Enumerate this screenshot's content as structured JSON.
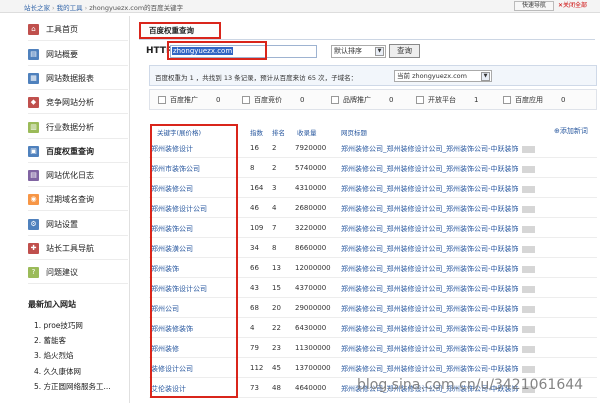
{
  "breadcrumb": {
    "items": [
      "站长之家",
      "我的工具",
      "zhongyuezx.com的百度关键字"
    ]
  },
  "top": {
    "quicknav": "快速导航",
    "close_all": "关闭全部"
  },
  "sidebar": {
    "items": [
      {
        "label": "工具首页",
        "icon": "home-icon",
        "color": "#c0504d"
      },
      {
        "label": "网站概要",
        "icon": "overview-icon",
        "color": "#4f81bd"
      },
      {
        "label": "网站数据报表",
        "icon": "report-icon",
        "color": "#4f81bd"
      },
      {
        "label": "竞争网站分析",
        "icon": "compete-icon",
        "color": "#c0504d"
      },
      {
        "label": "行业数据分析",
        "icon": "industry-icon",
        "color": "#9bbb59"
      },
      {
        "label": "百度权重查询",
        "icon": "baidu-weight-icon",
        "color": "#4f81bd"
      },
      {
        "label": "网站优化日志",
        "icon": "log-icon",
        "color": "#8064a2"
      },
      {
        "label": "过期域名查询",
        "icon": "expired-domain-icon",
        "color": "#f79646"
      },
      {
        "label": "网站设置",
        "icon": "settings-icon",
        "color": "#4f81bd"
      },
      {
        "label": "站长工具导航",
        "icon": "nav-icon",
        "color": "#c0504d"
      },
      {
        "label": "问题建议",
        "icon": "question-icon",
        "color": "#9bbb59"
      }
    ],
    "section_title": "最新加入网站",
    "sites": [
      "1. proe技巧网",
      "2. 蓄能客",
      "3. 焰火烈焰",
      "4. 久久康体网",
      "5. 方正圆网络服务工..."
    ]
  },
  "main": {
    "title": "百度权重查询",
    "http_label": "HTTP://",
    "domain_value": "zhongyuezx.com",
    "sort_value": "默认排序",
    "query_label": "查询",
    "summary_text": "百度权重为 1 ，共找到 13 条记录，预计从百度来访 65 次，子域名：",
    "site_select": "当前 zhongyuezx.com",
    "filters": [
      {
        "label": "百度推广",
        "count": "0"
      },
      {
        "label": "百度竞价",
        "count": "0"
      },
      {
        "label": "品牌推广",
        "count": "0"
      },
      {
        "label": "开放平台",
        "count": "1"
      },
      {
        "label": "百度应用",
        "count": "0"
      }
    ],
    "columns": {
      "keyword": "关键字(展价格)",
      "index": "指数",
      "rank": "排名",
      "inclusion": "收录量",
      "title": "网页标题"
    },
    "add_link": "添加新词",
    "rows": [
      {
        "kw": "郑州装修设计",
        "idx": "16",
        "rank": "2",
        "inc": "7920000",
        "ttl_b": "郑州装修公司_郑州装修设计公司_郑州装饰公司-中跃装饰"
      },
      {
        "kw": "郑州市装饰公司",
        "idx": "8",
        "rank": "2",
        "inc": "5740000",
        "ttl_b": "郑州装修公司_郑州装修设计公司_郑州装饰公司-中跃装饰"
      },
      {
        "kw": "郑州装修公司",
        "idx": "164",
        "rank": "3",
        "inc": "4310000",
        "ttl_b": "郑州装修公司_郑州装修设计公司_郑州装饰公司-中跃装饰"
      },
      {
        "kw": "郑州装修设计公司",
        "idx": "46",
        "rank": "4",
        "inc": "2680000",
        "ttl_b": "郑州装修公司_郑州装修设计公司_郑州装饰公司-中跃装饰"
      },
      {
        "kw": "郑州装饰公司",
        "idx": "109",
        "rank": "7",
        "inc": "3220000",
        "ttl_b": "郑州装修公司_郑州装修设计公司_郑州装饰公司-中跃装饰"
      },
      {
        "kw": "郑州装潢公司",
        "idx": "34",
        "rank": "8",
        "inc": "8660000",
        "ttl_b": "郑州装修公司_郑州装修设计公司_郑州装饰公司-中跃装饰"
      },
      {
        "kw": "郑州装饰",
        "idx": "66",
        "rank": "13",
        "inc": "12000000",
        "ttl_b": "郑州装修公司_郑州装修设计公司_郑州装饰公司-中跃装饰"
      },
      {
        "kw": "郑州装饰设计公司",
        "idx": "43",
        "rank": "15",
        "inc": "4370000",
        "ttl_b": "郑州装修公司_郑州装修设计公司_郑州装饰公司-中跃装饰"
      },
      {
        "kw": "郑州公司",
        "idx": "68",
        "rank": "20",
        "inc": "29000000",
        "ttl_b": "郑州装修公司_郑州装修设计公司_郑州装饰公司-中跃装饰"
      },
      {
        "kw": "郑州装修装饰",
        "idx": "4",
        "rank": "22",
        "inc": "6430000",
        "ttl_b": "郑州装修公司_郑州装修设计公司_郑州装饰公司-中跃装饰"
      },
      {
        "kw": "郑州装修",
        "idx": "79",
        "rank": "23",
        "inc": "11300000",
        "ttl_b": "郑州装修公司_郑州装修设计公司_郑州装饰公司-中跃装饰"
      },
      {
        "kw": "装修设计公司",
        "idx": "112",
        "rank": "45",
        "inc": "13700000",
        "ttl_b": "郑州装修公司_郑州装修设计公司_郑州装饰公司-中跃装饰"
      },
      {
        "kw": "艾伦装设计",
        "idx": "73",
        "rank": "48",
        "inc": "4640000",
        "ttl_b": "郑州装修公司_郑州装修设计公司_郑州装饰公司-中跃装饰"
      }
    ]
  },
  "watermark": "blog.sina.com.cn/u/3421061644"
}
